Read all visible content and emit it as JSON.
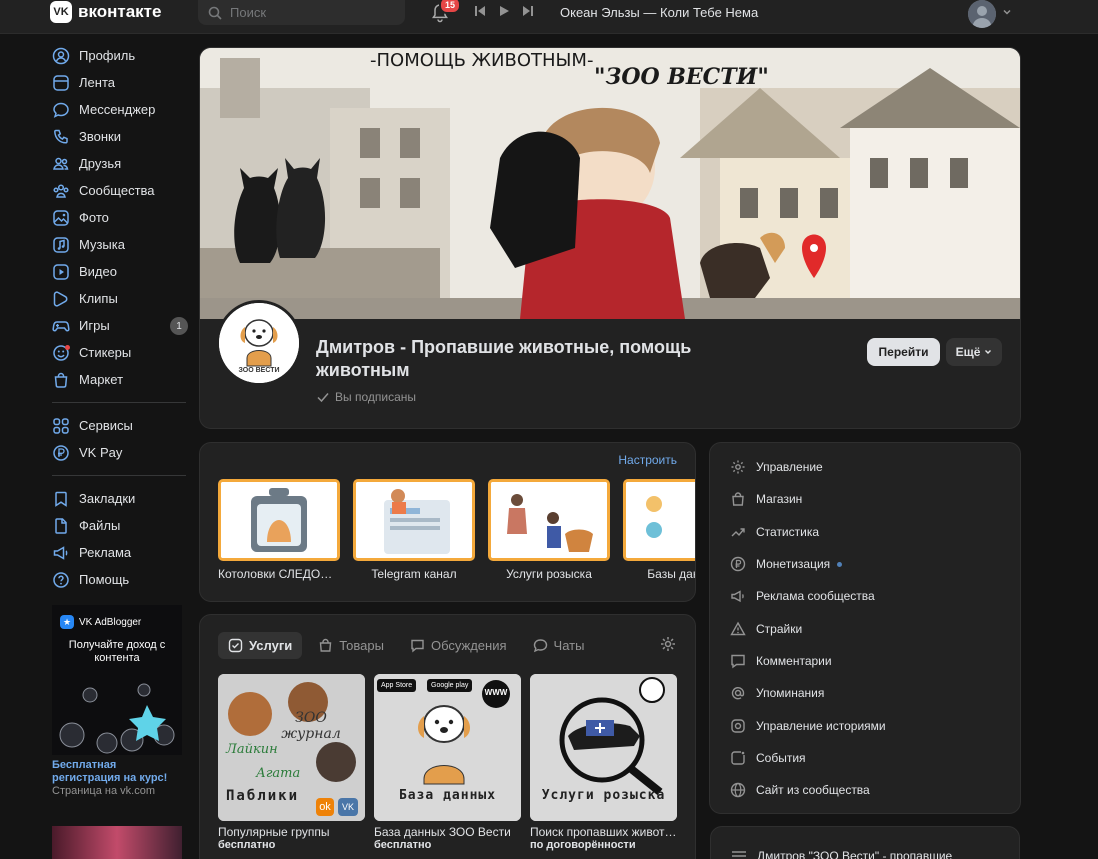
{
  "topbar": {
    "logo_mark": "VK",
    "logo_text": "вконтакте",
    "search_placeholder": "Поиск",
    "notifications_count": "15",
    "now_playing": "Океан Эльзы — Коли Тебе Нема"
  },
  "sidebar": {
    "group1": [
      {
        "label": "Профиль",
        "icon": "profile-icon"
      },
      {
        "label": "Лента",
        "icon": "feed-icon"
      },
      {
        "label": "Мессенджер",
        "icon": "messenger-icon"
      },
      {
        "label": "Звонки",
        "icon": "phone-icon"
      },
      {
        "label": "Друзья",
        "icon": "friends-icon"
      },
      {
        "label": "Сообщества",
        "icon": "communities-icon"
      },
      {
        "label": "Фото",
        "icon": "photo-icon"
      },
      {
        "label": "Музыка",
        "icon": "music-icon"
      },
      {
        "label": "Видео",
        "icon": "video-icon"
      },
      {
        "label": "Клипы",
        "icon": "clips-icon"
      },
      {
        "label": "Игры",
        "icon": "games-icon",
        "count": "1"
      },
      {
        "label": "Стикеры",
        "icon": "stickers-icon"
      },
      {
        "label": "Маркет",
        "icon": "market-icon"
      }
    ],
    "group2": [
      {
        "label": "Сервисы",
        "icon": "services-icon"
      },
      {
        "label": "VK Pay",
        "icon": "vkpay-icon"
      }
    ],
    "group3": [
      {
        "label": "Закладки",
        "icon": "bookmarks-icon"
      },
      {
        "label": "Файлы",
        "icon": "files-icon"
      },
      {
        "label": "Реклама",
        "icon": "ads-icon"
      },
      {
        "label": "Помощь",
        "icon": "help-icon"
      }
    ]
  },
  "ad": {
    "brand": "VK AdBlogger",
    "headline": "Получайте доход с контента",
    "title": "Бесплатная регистрация на курс!",
    "subtitle": "Страница на vk.com"
  },
  "cover": {
    "line1": "-ПОМОЩЬ ЖИВОТНЫМ-",
    "line2": "\"ЗОО ВЕСТИ\""
  },
  "group": {
    "logo_text": "ЗОО ВЕСТИ",
    "name": "Дмитров - Пропавшие животные, помощь животным",
    "status": "Вы подписаны",
    "go_button": "Перейти",
    "more_button": "Ещё"
  },
  "links": {
    "configure": "Настроить",
    "items": [
      {
        "label": "Котоловки СЛЕДОПЫТ"
      },
      {
        "label": "Telegram канал"
      },
      {
        "label": "Услуги розыска"
      },
      {
        "label": "Базы данных"
      }
    ]
  },
  "services": {
    "tabs": [
      {
        "label": "Услуги",
        "icon": "services-tab-icon"
      },
      {
        "label": "Товары",
        "icon": "bag-icon"
      },
      {
        "label": "Обсуждения",
        "icon": "discussion-icon"
      },
      {
        "label": "Чаты",
        "icon": "chats-icon"
      }
    ],
    "items": [
      {
        "caption": "Популярные группы",
        "price": "бесплатно",
        "overlay1": "ЗОО журнал",
        "overlay2": "Лайкин",
        "overlay3": "Агата",
        "overlay4": "Паблики"
      },
      {
        "caption": "База данных ЗОО Вести",
        "price": "бесплатно",
        "overlay1": "База данных",
        "store1": "App Store",
        "store2": "Google play",
        "www": "WWW"
      },
      {
        "caption": "Поиск пропавших животных",
        "price": "по договорённости",
        "overlay1": "Услуги розыска"
      }
    ]
  },
  "manage_menu": [
    {
      "label": "Управление",
      "icon": "gear-icon"
    },
    {
      "label": "Магазин",
      "icon": "shop-bag-icon"
    },
    {
      "label": "Статистика",
      "icon": "stats-icon"
    },
    {
      "label": "Монетизация",
      "icon": "ruble-icon",
      "dot": true
    },
    {
      "label": "Реклама сообщества",
      "icon": "megaphone-icon"
    },
    {
      "label": "Страйки",
      "icon": "warning-icon"
    },
    {
      "label": "Комментарии",
      "icon": "comment-icon"
    },
    {
      "label": "Упоминания",
      "icon": "at-icon"
    },
    {
      "label": "Управление историями",
      "icon": "stories-icon"
    },
    {
      "label": "События",
      "icon": "events-icon"
    },
    {
      "label": "Сайт из сообщества",
      "icon": "globe-icon"
    }
  ],
  "bottom_card": {
    "text": "Дмитров \"ЗОО Вести\" - пропавшие"
  },
  "colors": {
    "bg": "#141414",
    "card": "#222222",
    "accent_blue": "#71aaeb",
    "badge_red": "#e64646",
    "tile_border": "#f4a93b"
  }
}
